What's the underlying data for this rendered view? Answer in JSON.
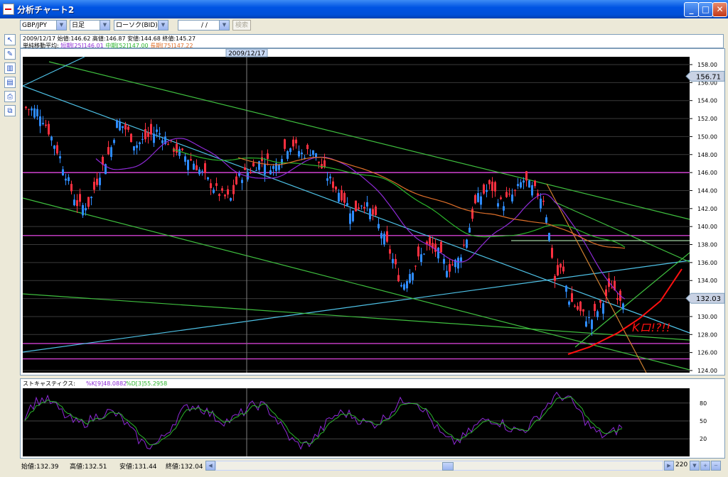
{
  "window": {
    "title": "分析チャート2"
  },
  "toolbar": {
    "pair": "GBP/JPY",
    "timeframe": "日足",
    "chart_type": "ローソク(BID)",
    "date_field": "/ /",
    "search_label": "検索"
  },
  "left_tools": [
    "cursor-tool-icon",
    "pencil-tool-icon",
    "chart-tool-icon",
    "indicator-tool-icon",
    "print-tool-icon",
    "copy-tool-icon"
  ],
  "info": {
    "line1": "2009/12/17  始値:146.62  高値:146.87  安値:144.68  終値:145.27",
    "ma_label": "単純移動平均:",
    "ma_short": "短期[25]146.01",
    "ma_mid": "中期[52]147.00",
    "ma_long": "長期[75]147.22"
  },
  "main": {
    "cursor_date": "2009/12/17",
    "price_ticks": [
      "158.00",
      "156.00",
      "154.00",
      "152.00",
      "150.00",
      "148.00",
      "146.00",
      "144.00",
      "142.00",
      "140.00",
      "138.00",
      "136.00",
      "134.00",
      "132.00",
      "130.00",
      "128.00",
      "126.00",
      "124.00"
    ],
    "current_price_tag": "156.71",
    "last_price_tag": "132.03",
    "annotation_text": "Kロ!?!!"
  },
  "stochastics": {
    "label": "ストキャスティクス:",
    "k_label": "%K[9]48.0882",
    "d_label": "%D[3]55.2958",
    "ticks": [
      "80",
      "50",
      "20"
    ]
  },
  "bottom": {
    "open": "始値:132.39",
    "high": "高値:132.51",
    "low": "安値:131.44",
    "close": "終値:132.04",
    "count": "220"
  },
  "colors": {
    "up": "#2e8cff",
    "down": "#ff3040",
    "ma_short": "#8e2ad6",
    "ma_mid": "#2bb52b",
    "ma_long": "#e0702a",
    "trend_cyan": "#4fc3e8",
    "trend_green": "#3fbf3f",
    "horizontal": "#d040d0",
    "annotation": "#ff1010"
  }
}
